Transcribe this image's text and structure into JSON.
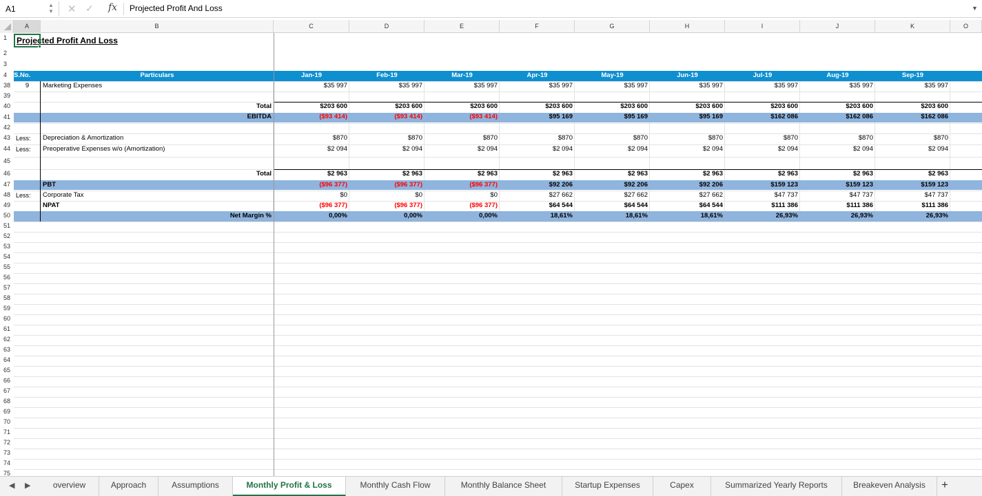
{
  "formula_bar": {
    "cell_ref": "A1",
    "cancel_icon": "x-icon",
    "confirm_icon": "check-icon",
    "fx_label": "fx",
    "value": "Projected Profit And Loss"
  },
  "columns": [
    "A",
    "B",
    "C",
    "D",
    "E",
    "F",
    "G",
    "H",
    "I",
    "J",
    "K",
    "O"
  ],
  "sheet": {
    "title": "Projected Profit And Loss",
    "header": {
      "sno": "S.No.",
      "particulars": "Particulars",
      "months": [
        "Jan-19",
        "Feb-19",
        "Mar-19",
        "Apr-19",
        "May-19",
        "Jun-19",
        "Jul-19",
        "Aug-19",
        "Sep-19"
      ]
    },
    "rows": {
      "marketing": {
        "sno": "9",
        "label": "Marketing Expenses",
        "values": [
          "$35 997",
          "$35 997",
          "$35 997",
          "$35 997",
          "$35 997",
          "$35 997",
          "$35 997",
          "$35 997",
          "$35 997"
        ]
      },
      "total1": {
        "label": "Total",
        "values": [
          "$203 600",
          "$203 600",
          "$203 600",
          "$203 600",
          "$203 600",
          "$203 600",
          "$203 600",
          "$203 600",
          "$203 600"
        ]
      },
      "ebitda": {
        "label": "EBITDA",
        "values": [
          "($93 414)",
          "($93 414)",
          "($93 414)",
          "$95 169",
          "$95 169",
          "$95 169",
          "$162 086",
          "$162 086",
          "$162 086"
        ]
      },
      "depreciation": {
        "prefix": "Less:",
        "label": "Depreciation & Amortization",
        "values": [
          "$870",
          "$870",
          "$870",
          "$870",
          "$870",
          "$870",
          "$870",
          "$870",
          "$870"
        ]
      },
      "preoperative": {
        "prefix": "Less:",
        "label": "Preoperative Expenses w/o (Amortization)",
        "values": [
          "$2 094",
          "$2 094",
          "$2 094",
          "$2 094",
          "$2 094",
          "$2 094",
          "$2 094",
          "$2 094",
          "$2 094"
        ]
      },
      "total2": {
        "label": "Total",
        "values": [
          "$2 963",
          "$2 963",
          "$2 963",
          "$2 963",
          "$2 963",
          "$2 963",
          "$2 963",
          "$2 963",
          "$2 963"
        ]
      },
      "pbt": {
        "label": "PBT",
        "values": [
          "($96 377)",
          "($96 377)",
          "($96 377)",
          "$92 206",
          "$92 206",
          "$92 206",
          "$159 123",
          "$159 123",
          "$159 123"
        ]
      },
      "tax": {
        "prefix": "Less:",
        "label": "Corporate Tax",
        "values": [
          "$0",
          "$0",
          "$0",
          "$27 662",
          "$27 662",
          "$27 662",
          "$47 737",
          "$47 737",
          "$47 737"
        ]
      },
      "npat": {
        "label": "NPAT",
        "values": [
          "($96 377)",
          "($96 377)",
          "($96 377)",
          "$64 544",
          "$64 544",
          "$64 544",
          "$111 386",
          "$111 386",
          "$111 386"
        ]
      },
      "margin": {
        "label": "Net Margin %",
        "values": [
          "0,00%",
          "0,00%",
          "0,00%",
          "18,61%",
          "18,61%",
          "18,61%",
          "26,93%",
          "26,93%",
          "26,93%"
        ]
      }
    }
  },
  "row_numbers": [
    "1",
    "2",
    "3",
    "4",
    "38",
    "39",
    "40",
    "41",
    "42",
    "43",
    "44",
    "45",
    "46",
    "47",
    "48",
    "49",
    "50",
    "51",
    "52",
    "53",
    "54",
    "55",
    "56",
    "57",
    "58",
    "59",
    "60",
    "61",
    "62",
    "63",
    "64",
    "65",
    "66",
    "67",
    "68",
    "69",
    "70",
    "71",
    "72",
    "73",
    "74",
    "75"
  ],
  "tabs": [
    "overview",
    "Approach",
    "Assumptions",
    "Monthly Profit & Loss",
    "Monthly Cash Flow",
    "Monthly Balance Sheet",
    "Startup Expenses",
    "Capex",
    "Summarized Yearly Reports",
    "Breakeven Analysis"
  ],
  "active_tab": "Monthly Profit & Loss",
  "colors": {
    "header_band": "#0e8fd0",
    "light_band": "#8fb4dd",
    "negative": "#ff0000",
    "accent": "#217346"
  }
}
